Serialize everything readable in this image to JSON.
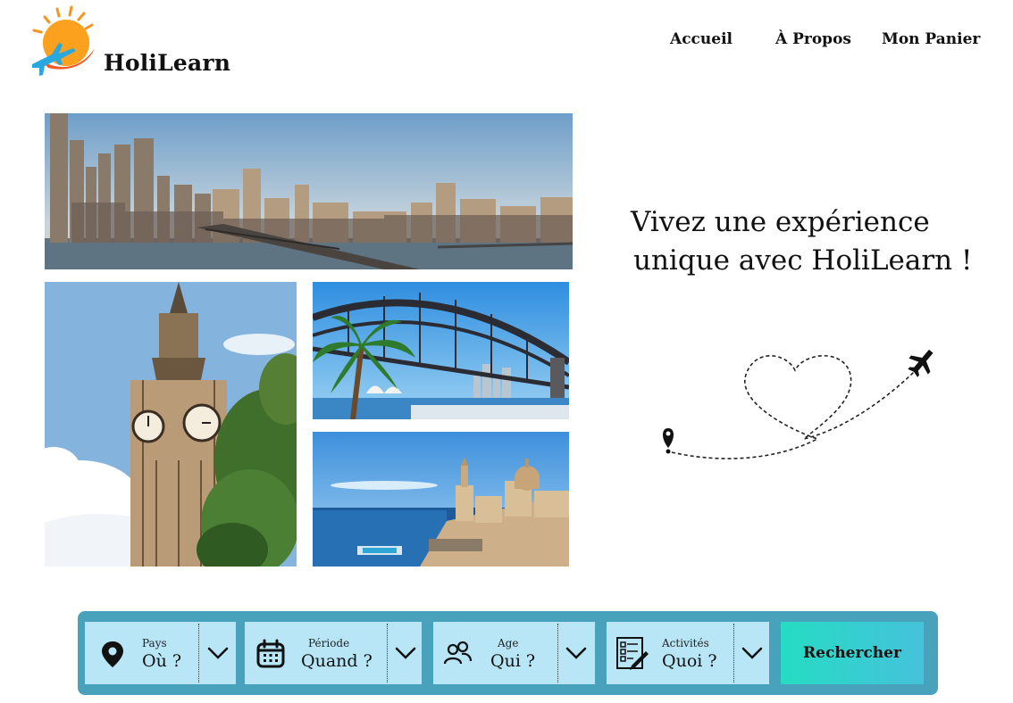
{
  "brand": {
    "name": "HoliLearn"
  },
  "nav": {
    "home": "Accueil",
    "about": "À Propos",
    "cart": "Mon Panier"
  },
  "hero": {
    "tagline_line1": "Vivez une expérience",
    "tagline_line2": "unique avec HoliLearn !"
  },
  "search": {
    "country_label": "Pays",
    "country_value": "Où ?",
    "period_label": "Période",
    "period_value": "Quand ?",
    "age_label": "Age",
    "age_value": "Qui ?",
    "activity_label": "Activités",
    "activity_value": "Quoi ?",
    "submit_label": "Rechercher"
  },
  "icons": {
    "country": "map-pin-icon",
    "period": "calendar-icon",
    "age": "people-icon",
    "activity": "checklist-icon",
    "dropdown": "chevron-down-icon"
  },
  "colors": {
    "search_bar": "#48a2bb",
    "field_bg": "#b8e6f7",
    "button_gradient_start": "#26dcc3",
    "button_gradient_end": "#45c2dc",
    "logo_sun": "#f7941d",
    "logo_plane": "#29a8e0"
  }
}
